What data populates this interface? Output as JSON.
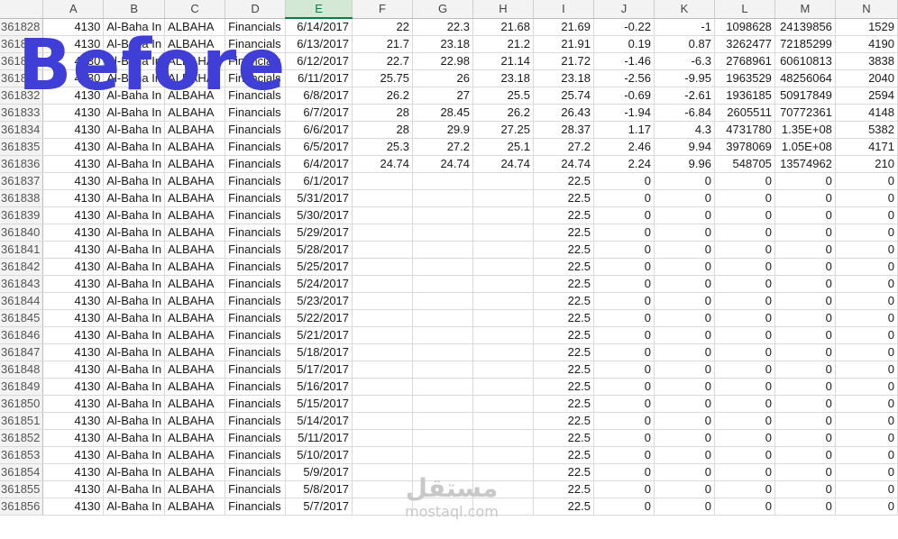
{
  "overlay": {
    "title": "Before"
  },
  "watermark": {
    "arabic": "مستقل",
    "latin": "mostaql.com"
  },
  "grid": {
    "columns": [
      "A",
      "B",
      "C",
      "D",
      "E",
      "F",
      "G",
      "H",
      "I",
      "J",
      "K",
      "L",
      "M",
      "N"
    ],
    "selected_column": "E",
    "rows": [
      {
        "n": "361828",
        "a": "4130",
        "b": "Al-Baha In",
        "c": "ALBAHA",
        "d": "Financials",
        "e": "6/14/2017",
        "f": "22",
        "g": "22.3",
        "h": "21.68",
        "i": "21.69",
        "j": "-0.22",
        "k": "-1",
        "l": "1098628",
        "m": "24139856",
        "o": "1529"
      },
      {
        "n": "361829",
        "a": "4130",
        "b": "Al-Baha In",
        "c": "ALBAHA",
        "d": "Financials",
        "e": "6/13/2017",
        "f": "21.7",
        "g": "23.18",
        "h": "21.2",
        "i": "21.91",
        "j": "0.19",
        "k": "0.87",
        "l": "3262477",
        "m": "72185299",
        "o": "4190"
      },
      {
        "n": "361830",
        "a": "4130",
        "b": "Al-Baha In",
        "c": "ALBAHA",
        "d": "Financials",
        "e": "6/12/2017",
        "f": "22.7",
        "g": "22.98",
        "h": "21.14",
        "i": "21.72",
        "j": "-1.46",
        "k": "-6.3",
        "l": "2768961",
        "m": "60610813",
        "o": "3838"
      },
      {
        "n": "361831",
        "a": "4130",
        "b": "Al-Baha In",
        "c": "ALBAHA",
        "d": "Financials",
        "e": "6/11/2017",
        "f": "25.75",
        "g": "26",
        "h": "23.18",
        "i": "23.18",
        "j": "-2.56",
        "k": "-9.95",
        "l": "1963529",
        "m": "48256064",
        "o": "2040"
      },
      {
        "n": "361832",
        "a": "4130",
        "b": "Al-Baha In",
        "c": "ALBAHA",
        "d": "Financials",
        "e": "6/8/2017",
        "f": "26.2",
        "g": "27",
        "h": "25.5",
        "i": "25.74",
        "j": "-0.69",
        "k": "-2.61",
        "l": "1936185",
        "m": "50917849",
        "o": "2594"
      },
      {
        "n": "361833",
        "a": "4130",
        "b": "Al-Baha In",
        "c": "ALBAHA",
        "d": "Financials",
        "e": "6/7/2017",
        "f": "28",
        "g": "28.45",
        "h": "26.2",
        "i": "26.43",
        "j": "-1.94",
        "k": "-6.84",
        "l": "2605511",
        "m": "70772361",
        "o": "4148"
      },
      {
        "n": "361834",
        "a": "4130",
        "b": "Al-Baha In",
        "c": "ALBAHA",
        "d": "Financials",
        "e": "6/6/2017",
        "f": "28",
        "g": "29.9",
        "h": "27.25",
        "i": "28.37",
        "j": "1.17",
        "k": "4.3",
        "l": "4731780",
        "m": "1.35E+08",
        "o": "5382"
      },
      {
        "n": "361835",
        "a": "4130",
        "b": "Al-Baha In",
        "c": "ALBAHA",
        "d": "Financials",
        "e": "6/5/2017",
        "f": "25.3",
        "g": "27.2",
        "h": "25.1",
        "i": "27.2",
        "j": "2.46",
        "k": "9.94",
        "l": "3978069",
        "m": "1.05E+08",
        "o": "4171"
      },
      {
        "n": "361836",
        "a": "4130",
        "b": "Al-Baha In",
        "c": "ALBAHA",
        "d": "Financials",
        "e": "6/4/2017",
        "f": "24.74",
        "g": "24.74",
        "h": "24.74",
        "i": "24.74",
        "j": "2.24",
        "k": "9.96",
        "l": "548705",
        "m": "13574962",
        "o": "210"
      },
      {
        "n": "361837",
        "a": "4130",
        "b": "Al-Baha In",
        "c": "ALBAHA",
        "d": "Financials",
        "e": "6/1/2017",
        "f": "",
        "g": "",
        "h": "",
        "i": "22.5",
        "j": "0",
        "k": "0",
        "l": "0",
        "m": "0",
        "o": "0"
      },
      {
        "n": "361838",
        "a": "4130",
        "b": "Al-Baha In",
        "c": "ALBAHA",
        "d": "Financials",
        "e": "5/31/2017",
        "f": "",
        "g": "",
        "h": "",
        "i": "22.5",
        "j": "0",
        "k": "0",
        "l": "0",
        "m": "0",
        "o": "0"
      },
      {
        "n": "361839",
        "a": "4130",
        "b": "Al-Baha In",
        "c": "ALBAHA",
        "d": "Financials",
        "e": "5/30/2017",
        "f": "",
        "g": "",
        "h": "",
        "i": "22.5",
        "j": "0",
        "k": "0",
        "l": "0",
        "m": "0",
        "o": "0"
      },
      {
        "n": "361840",
        "a": "4130",
        "b": "Al-Baha In",
        "c": "ALBAHA",
        "d": "Financials",
        "e": "5/29/2017",
        "f": "",
        "g": "",
        "h": "",
        "i": "22.5",
        "j": "0",
        "k": "0",
        "l": "0",
        "m": "0",
        "o": "0"
      },
      {
        "n": "361841",
        "a": "4130",
        "b": "Al-Baha In",
        "c": "ALBAHA",
        "d": "Financials",
        "e": "5/28/2017",
        "f": "",
        "g": "",
        "h": "",
        "i": "22.5",
        "j": "0",
        "k": "0",
        "l": "0",
        "m": "0",
        "o": "0"
      },
      {
        "n": "361842",
        "a": "4130",
        "b": "Al-Baha In",
        "c": "ALBAHA",
        "d": "Financials",
        "e": "5/25/2017",
        "f": "",
        "g": "",
        "h": "",
        "i": "22.5",
        "j": "0",
        "k": "0",
        "l": "0",
        "m": "0",
        "o": "0"
      },
      {
        "n": "361843",
        "a": "4130",
        "b": "Al-Baha In",
        "c": "ALBAHA",
        "d": "Financials",
        "e": "5/24/2017",
        "f": "",
        "g": "",
        "h": "",
        "i": "22.5",
        "j": "0",
        "k": "0",
        "l": "0",
        "m": "0",
        "o": "0"
      },
      {
        "n": "361844",
        "a": "4130",
        "b": "Al-Baha In",
        "c": "ALBAHA",
        "d": "Financials",
        "e": "5/23/2017",
        "f": "",
        "g": "",
        "h": "",
        "i": "22.5",
        "j": "0",
        "k": "0",
        "l": "0",
        "m": "0",
        "o": "0"
      },
      {
        "n": "361845",
        "a": "4130",
        "b": "Al-Baha In",
        "c": "ALBAHA",
        "d": "Financials",
        "e": "5/22/2017",
        "f": "",
        "g": "",
        "h": "",
        "i": "22.5",
        "j": "0",
        "k": "0",
        "l": "0",
        "m": "0",
        "o": "0"
      },
      {
        "n": "361846",
        "a": "4130",
        "b": "Al-Baha In",
        "c": "ALBAHA",
        "d": "Financials",
        "e": "5/21/2017",
        "f": "",
        "g": "",
        "h": "",
        "i": "22.5",
        "j": "0",
        "k": "0",
        "l": "0",
        "m": "0",
        "o": "0"
      },
      {
        "n": "361847",
        "a": "4130",
        "b": "Al-Baha In",
        "c": "ALBAHA",
        "d": "Financials",
        "e": "5/18/2017",
        "f": "",
        "g": "",
        "h": "",
        "i": "22.5",
        "j": "0",
        "k": "0",
        "l": "0",
        "m": "0",
        "o": "0"
      },
      {
        "n": "361848",
        "a": "4130",
        "b": "Al-Baha In",
        "c": "ALBAHA",
        "d": "Financials",
        "e": "5/17/2017",
        "f": "",
        "g": "",
        "h": "",
        "i": "22.5",
        "j": "0",
        "k": "0",
        "l": "0",
        "m": "0",
        "o": "0"
      },
      {
        "n": "361849",
        "a": "4130",
        "b": "Al-Baha In",
        "c": "ALBAHA",
        "d": "Financials",
        "e": "5/16/2017",
        "f": "",
        "g": "",
        "h": "",
        "i": "22.5",
        "j": "0",
        "k": "0",
        "l": "0",
        "m": "0",
        "o": "0"
      },
      {
        "n": "361850",
        "a": "4130",
        "b": "Al-Baha In",
        "c": "ALBAHA",
        "d": "Financials",
        "e": "5/15/2017",
        "f": "",
        "g": "",
        "h": "",
        "i": "22.5",
        "j": "0",
        "k": "0",
        "l": "0",
        "m": "0",
        "o": "0"
      },
      {
        "n": "361851",
        "a": "4130",
        "b": "Al-Baha In",
        "c": "ALBAHA",
        "d": "Financials",
        "e": "5/14/2017",
        "f": "",
        "g": "",
        "h": "",
        "i": "22.5",
        "j": "0",
        "k": "0",
        "l": "0",
        "m": "0",
        "o": "0"
      },
      {
        "n": "361852",
        "a": "4130",
        "b": "Al-Baha In",
        "c": "ALBAHA",
        "d": "Financials",
        "e": "5/11/2017",
        "f": "",
        "g": "",
        "h": "",
        "i": "22.5",
        "j": "0",
        "k": "0",
        "l": "0",
        "m": "0",
        "o": "0"
      },
      {
        "n": "361853",
        "a": "4130",
        "b": "Al-Baha In",
        "c": "ALBAHA",
        "d": "Financials",
        "e": "5/10/2017",
        "f": "",
        "g": "",
        "h": "",
        "i": "22.5",
        "j": "0",
        "k": "0",
        "l": "0",
        "m": "0",
        "o": "0"
      },
      {
        "n": "361854",
        "a": "4130",
        "b": "Al-Baha In",
        "c": "ALBAHA",
        "d": "Financials",
        "e": "5/9/2017",
        "f": "",
        "g": "",
        "h": "",
        "i": "22.5",
        "j": "0",
        "k": "0",
        "l": "0",
        "m": "0",
        "o": "0"
      },
      {
        "n": "361855",
        "a": "4130",
        "b": "Al-Baha In",
        "c": "ALBAHA",
        "d": "Financials",
        "e": "5/8/2017",
        "f": "",
        "g": "",
        "h": "",
        "i": "22.5",
        "j": "0",
        "k": "0",
        "l": "0",
        "m": "0",
        "o": "0"
      },
      {
        "n": "361856",
        "a": "4130",
        "b": "Al-Baha In",
        "c": "ALBAHA",
        "d": "Financials",
        "e": "5/7/2017",
        "f": "",
        "g": "",
        "h": "",
        "i": "22.5",
        "j": "0",
        "k": "0",
        "l": "0",
        "m": "0",
        "o": "0"
      }
    ]
  }
}
